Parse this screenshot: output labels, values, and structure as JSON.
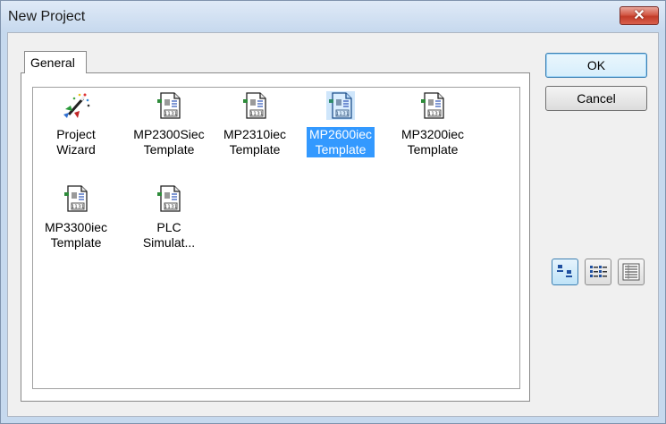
{
  "window": {
    "title": "New Project",
    "close_glyph": "✕"
  },
  "tabs": [
    {
      "label": "General",
      "active": true
    }
  ],
  "templates": [
    {
      "line1": "Project",
      "line2": "Wizard",
      "icon": "wizard-icon",
      "selected": false
    },
    {
      "line1": "MP2300Siec",
      "line2": "Template",
      "icon": "template-document-icon",
      "selected": false
    },
    {
      "line1": "MP2310iec",
      "line2": "Template",
      "icon": "template-document-icon",
      "selected": false
    },
    {
      "line1": "MP2600iec",
      "line2": "Template",
      "icon": "template-document-icon",
      "selected": true
    },
    {
      "line1": "MP3200iec",
      "line2": "Template",
      "icon": "template-document-icon",
      "selected": false
    },
    {
      "line1": "MP3300iec",
      "line2": "Template",
      "icon": "template-document-icon",
      "selected": false
    },
    {
      "line1": "PLC",
      "line2": "Simulat...",
      "icon": "template-document-icon",
      "selected": false
    }
  ],
  "buttons": {
    "ok": "OK",
    "cancel": "Cancel"
  },
  "view_modes": [
    {
      "name": "large-icons-view",
      "active": true
    },
    {
      "name": "list-view",
      "active": false
    },
    {
      "name": "details-view",
      "active": false
    }
  ],
  "colors": {
    "selection": "#3399ff",
    "frame": "#c6d9ee",
    "close": "#c23b28"
  }
}
